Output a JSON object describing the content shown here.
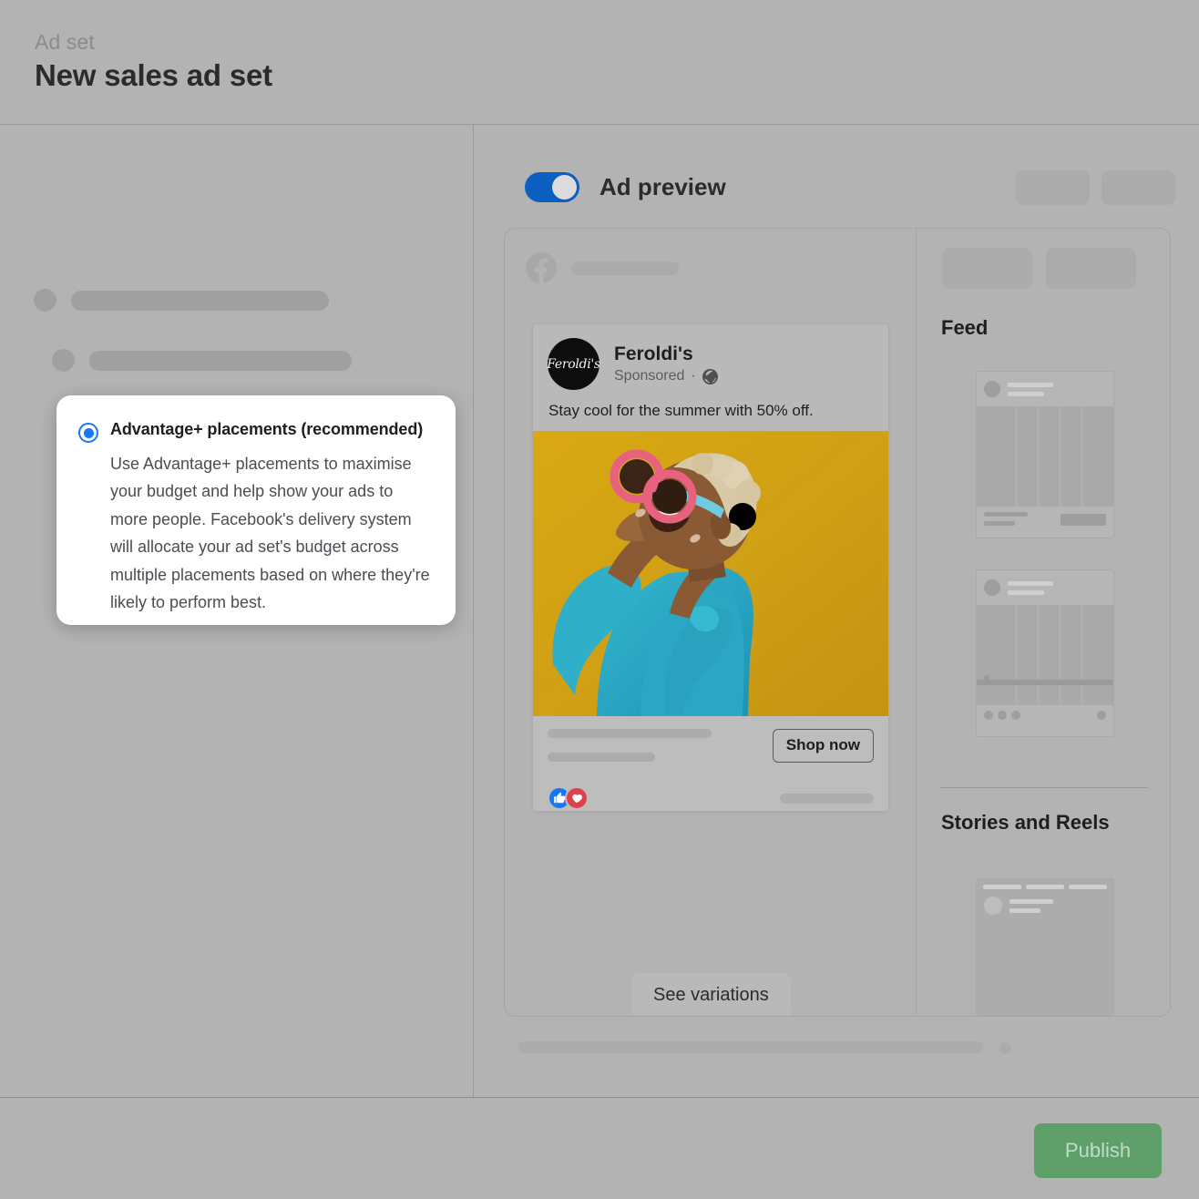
{
  "header": {
    "eyebrow": "Ad set",
    "title": "New sales ad set"
  },
  "callout": {
    "radio_selected": true,
    "title": "Advantage+ placements (recommended)",
    "body": "Use Advantage+ placements to maximise your budget and help show your ads to more people. Facebook's delivery system will allocate your ad set's budget across multiple placements based on where they're likely to perform best.",
    "accent_color": "#1877f2"
  },
  "preview": {
    "toggle_on": true,
    "toggle_color": "#0b5fc1",
    "label": "Ad preview",
    "see_variations_label": "See variations",
    "fb_icon": "facebook-icon"
  },
  "ad": {
    "brand_logo_text": "Feroldi's",
    "brand_name": "Feroldi's",
    "sponsored_label": "Sponsored",
    "separator": "·",
    "audience_icon": "globe-icon",
    "primary_text": "Stay cool for the summer with 50% off.",
    "cta_label": "Shop now",
    "reactions": [
      "like-icon",
      "love-icon"
    ],
    "photo": {
      "background_color": "#cf9f15",
      "shirt_color": "#2ba7c4",
      "glasses_color": "#e8617f",
      "hair_color": "#d8c9a8",
      "skin_color": "#8a5a34"
    }
  },
  "placements": {
    "feed_title": "Feed",
    "stories_title": "Stories and Reels"
  },
  "footer": {
    "publish_label": "Publish",
    "publish_color": "#5fa06a"
  }
}
